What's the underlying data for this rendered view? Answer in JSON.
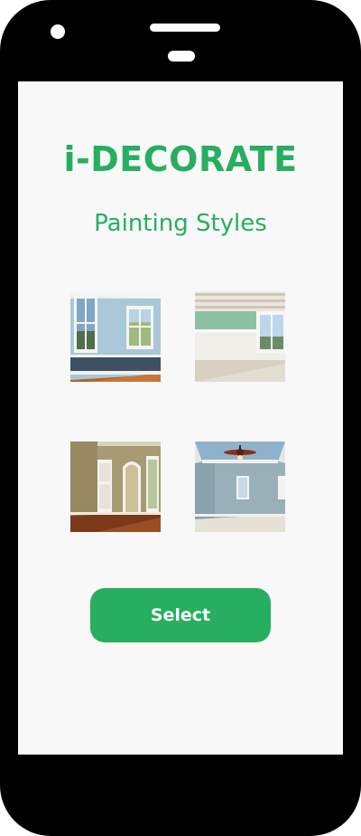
{
  "app": {
    "title": "i-DECORATE",
    "subtitle": "Painting Styles"
  },
  "styles": [
    {
      "icon": "blue-wall-room-photo"
    },
    {
      "icon": "green-wall-room-photo"
    },
    {
      "icon": "beige-wall-room-photo"
    },
    {
      "icon": "blue-gray-room-with-ceiling-fan-photo"
    }
  ],
  "actions": {
    "select_label": "Select"
  },
  "colors": {
    "accent": "#27ae60",
    "screen_background": "#f8f8f8",
    "device_frame": "#000000"
  }
}
